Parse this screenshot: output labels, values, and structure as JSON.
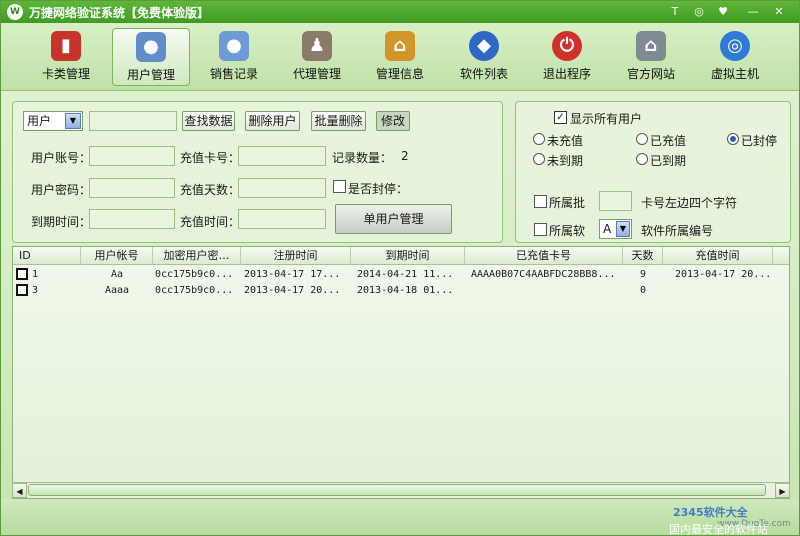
{
  "window": {
    "title": "万捷网络验证系统【免费体验版】"
  },
  "title_buttons": [
    "T",
    "◎",
    "♥",
    "—",
    "✕"
  ],
  "toolbar": {
    "items": [
      {
        "label": "卡类管理",
        "icon": "card-icon",
        "color": "#c8342a"
      },
      {
        "label": "用户管理",
        "icon": "users-icon",
        "color": "#5f8ec9",
        "active": true
      },
      {
        "label": "销售记录",
        "icon": "sales-icon",
        "color": "#6d9bd3"
      },
      {
        "label": "代理管理",
        "icon": "agent-icon",
        "color": "#8a7a6a"
      },
      {
        "label": "管理信息",
        "icon": "info-icon",
        "color": "#d1952a"
      },
      {
        "label": "软件列表",
        "icon": "software-icon",
        "color": "#2f67c4"
      },
      {
        "label": "退出程序",
        "icon": "power-icon",
        "color": "#d0302a"
      },
      {
        "label": "官方网站",
        "icon": "home-icon",
        "color": "#7f8b93"
      },
      {
        "label": "虚拟主机",
        "icon": "globe-icon",
        "color": "#2f7ad6"
      }
    ]
  },
  "search": {
    "type_select": "用户",
    "search_button": "查找数据",
    "delete_button": "删除用户",
    "batch_delete_button": "批量删除",
    "modify_button": "修改"
  },
  "form": {
    "account_label": "用户账号：",
    "password_label": "用户密码：",
    "expire_label": "到期时间：",
    "card_label": "充值卡号：",
    "days_label": "充值天数：",
    "recharge_time_label": "充值时间：",
    "record_count_label": "记录数量：",
    "record_count_value": "2",
    "banned_label": "是否封停：",
    "single_user_button": "单用户管理"
  },
  "filters": {
    "show_all_label": "显示所有用户",
    "show_all_checked": true,
    "radios": [
      {
        "label": "未充值",
        "on": false
      },
      {
        "label": "已充值",
        "on": false
      },
      {
        "label": "已封停",
        "on": true
      },
      {
        "label": "未到期",
        "on": false
      },
      {
        "label": "已到期",
        "on": false
      }
    ],
    "batch_label": "所属批",
    "card_prefix_label": "卡号左边四个字符",
    "software_label": "所属软",
    "software_select": "A",
    "software_id_label": "软件所属编号"
  },
  "table": {
    "columns": [
      "ID",
      "用户帐号",
      "加密用户密…",
      "注册时间",
      "到期时间",
      "已充值卡号",
      "天数",
      "充值时间"
    ],
    "rows": [
      {
        "id": "1",
        "account": "Aa",
        "pwd": "0cc175b9c0...",
        "reg": "2013-04-17 17...",
        "exp": "2014-04-21 11...",
        "card": "AAAA0B07C4AABFDC28BB8...",
        "days": "9",
        "recharge": "2013-04-17 20..."
      },
      {
        "id": "3",
        "account": "Aaaa",
        "pwd": "0cc175b9c0...",
        "reg": "2013-04-17 20...",
        "exp": "2013-04-18 01...",
        "card": "",
        "days": "0",
        "recharge": ""
      }
    ]
  },
  "watermark": {
    "site": "2345软件大全",
    "url": "www.DuoTe.com",
    "slogan": "国内最安全的软件站"
  }
}
